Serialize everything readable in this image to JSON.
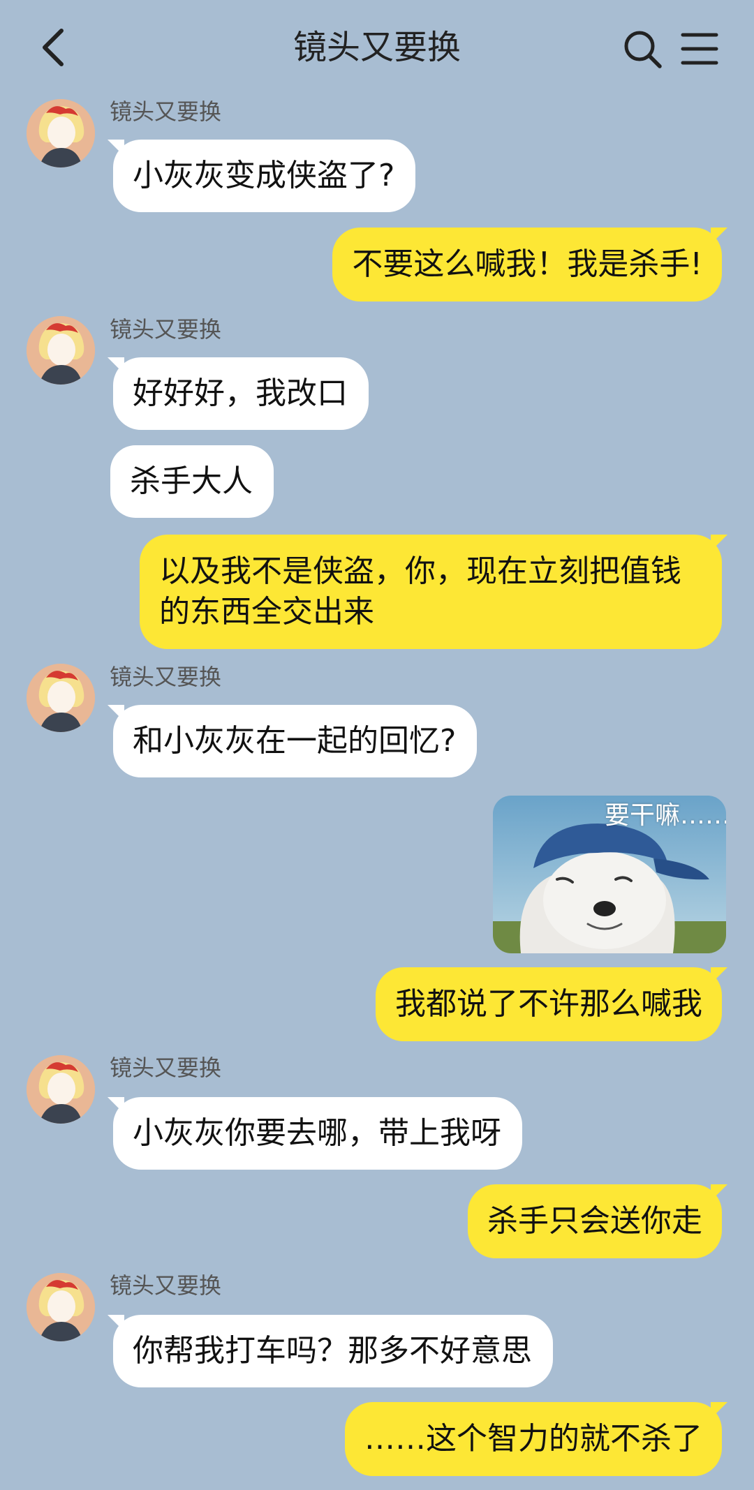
{
  "header": {
    "title": "镜头又要换",
    "back_icon": "chevron-left-icon",
    "search_icon": "search-icon",
    "menu_icon": "hamburger-menu-icon"
  },
  "contact": {
    "name": "镜头又要换"
  },
  "messages": [
    {
      "side": "in",
      "text": "小灰灰变成侠盗了?"
    },
    {
      "side": "out",
      "text": "不要这么喊我！我是杀手!"
    },
    {
      "side": "in",
      "text": "好好好，我改口"
    },
    {
      "side": "in",
      "text": "杀手大人"
    },
    {
      "side": "out",
      "text": "以及我不是侠盗，你，现在立刻把值钱的东西全交出来"
    },
    {
      "side": "in",
      "text": "和小灰灰在一起的回忆?"
    },
    {
      "side": "out",
      "type": "sticker",
      "text": "要干嘛……",
      "image": "dog-wearing-blue-cap"
    },
    {
      "side": "out",
      "text": "我都说了不许那么喊我"
    },
    {
      "side": "in",
      "text": "小灰灰你要去哪，带上我呀"
    },
    {
      "side": "out",
      "text": "杀手只会送你走"
    },
    {
      "side": "in",
      "text": "你帮我打车吗？那多不好意思"
    },
    {
      "side": "out",
      "text": "……这个智力的就不杀了"
    }
  ],
  "colors": {
    "background": "#a8bdd2",
    "incoming_bubble": "#ffffff",
    "outgoing_bubble": "#fde735"
  }
}
